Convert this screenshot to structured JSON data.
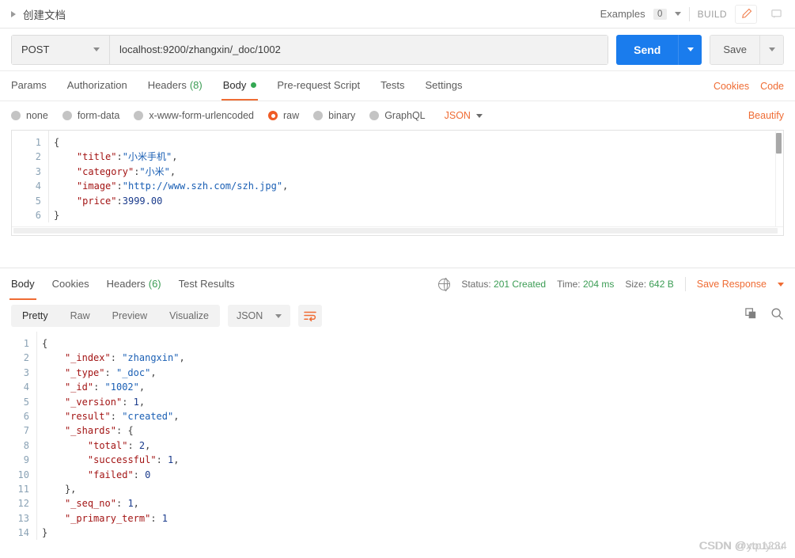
{
  "tabbar": {
    "tab_title": "创建文档",
    "run_icon": "play-triangle-icon",
    "examples_label": "Examples",
    "examples_count": "0",
    "build_label": "BUILD",
    "edit_icon": "pencil-icon",
    "comment_icon": "comment-icon"
  },
  "request": {
    "method": "POST",
    "url": "localhost:9200/zhangxin/_doc/1002",
    "send_label": "Send",
    "save_label": "Save",
    "tabs": [
      {
        "label": "Params",
        "active": false
      },
      {
        "label": "Authorization",
        "active": false
      },
      {
        "label": "Headers",
        "count": "(8)",
        "active": false
      },
      {
        "label": "Body",
        "active": true,
        "dot": true
      },
      {
        "label": "Pre-request Script",
        "active": false
      },
      {
        "label": "Tests",
        "active": false
      },
      {
        "label": "Settings",
        "active": false
      }
    ],
    "cookies_link": "Cookies",
    "code_link": "Code",
    "beautify_link": "Beautify",
    "body_types": [
      {
        "label": "none",
        "selected": false
      },
      {
        "label": "form-data",
        "selected": false
      },
      {
        "label": "x-www-form-urlencoded",
        "selected": false
      },
      {
        "label": "raw",
        "selected": true
      },
      {
        "label": "binary",
        "selected": false
      },
      {
        "label": "GraphQL",
        "selected": false
      }
    ],
    "raw_format": "JSON",
    "body_lines": [
      {
        "n": "1",
        "text": "{"
      },
      {
        "n": "2",
        "text": "    \"title\":\"小米手机\","
      },
      {
        "n": "3",
        "text": "    \"category\":\"小米\","
      },
      {
        "n": "4",
        "text": "    \"image\":\"http://www.szh.com/szh.jpg\","
      },
      {
        "n": "5",
        "text": "    \"price\":3999.00"
      },
      {
        "n": "6",
        "text": "}"
      }
    ]
  },
  "response": {
    "tabs": [
      {
        "label": "Body",
        "active": true
      },
      {
        "label": "Cookies",
        "active": false
      },
      {
        "label": "Headers",
        "count": "(6)",
        "active": false
      },
      {
        "label": "Test Results",
        "active": false
      }
    ],
    "status_label": "Status:",
    "status_value": "201 Created",
    "time_label": "Time:",
    "time_value": "204 ms",
    "size_label": "Size:",
    "size_value": "642 B",
    "save_response": "Save Response",
    "globe_icon": "globe-icon",
    "view_modes": [
      {
        "label": "Pretty",
        "active": true
      },
      {
        "label": "Raw",
        "active": false
      },
      {
        "label": "Preview",
        "active": false
      },
      {
        "label": "Visualize",
        "active": false
      }
    ],
    "format": "JSON",
    "wrap_icon": "word-wrap-icon",
    "copy_icon": "copy-icon",
    "search_icon": "search-icon",
    "body_lines": [
      {
        "n": "1",
        "text": "{"
      },
      {
        "n": "2",
        "text": "    \"_index\": \"zhangxin\","
      },
      {
        "n": "3",
        "text": "    \"_type\": \"_doc\","
      },
      {
        "n": "4",
        "text": "    \"_id\": \"1002\","
      },
      {
        "n": "5",
        "text": "    \"_version\": 1,"
      },
      {
        "n": "6",
        "text": "    \"result\": \"created\","
      },
      {
        "n": "7",
        "text": "    \"_shards\": {"
      },
      {
        "n": "8",
        "text": "        \"total\": 2,"
      },
      {
        "n": "9",
        "text": "        \"successful\": 1,"
      },
      {
        "n": "10",
        "text": "        \"failed\": 0"
      },
      {
        "n": "11",
        "text": "    },"
      },
      {
        "n": "12",
        "text": "    \"_seq_no\": 1,"
      },
      {
        "n": "13",
        "text": "    \"_primary_term\": 1"
      },
      {
        "n": "14",
        "text": "}"
      }
    ]
  },
  "watermark": {
    "text_a": "CSDN @youyou",
    "text_b": "CSDN @xtp1234"
  },
  "colors": {
    "accent_orange": "#ef6c34",
    "send_blue": "#1a7ced",
    "status_green": "#3b9c54"
  }
}
